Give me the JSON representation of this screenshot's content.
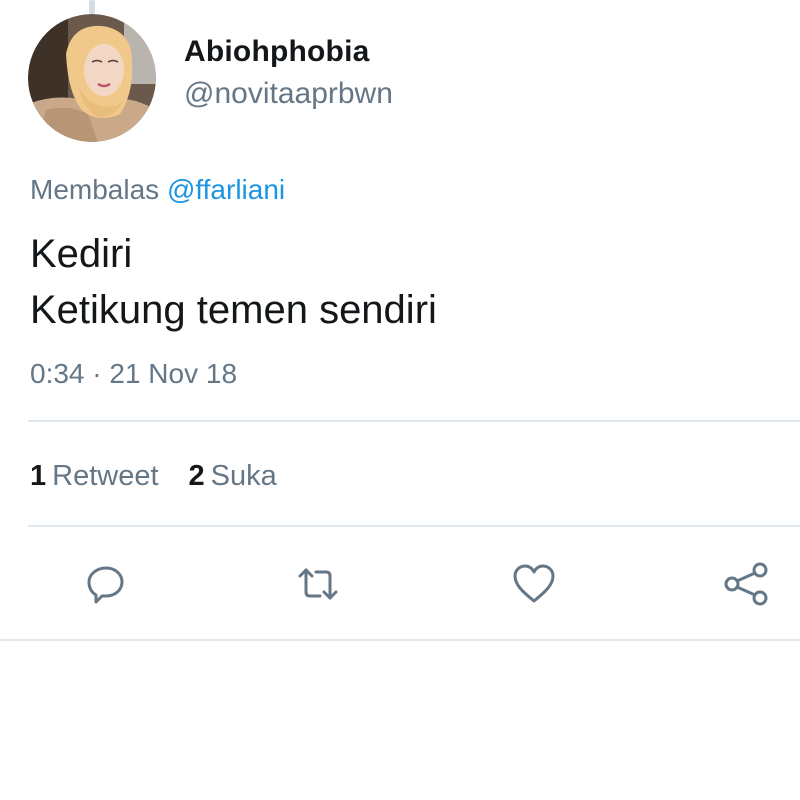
{
  "author": {
    "display_name": "Abiohphobia",
    "handle": "@novitaaprbwn"
  },
  "reply_context": {
    "prefix": "Membalas",
    "mention": "@ffarliani"
  },
  "tweet": {
    "lines": [
      "Kediri",
      "Ketikung temen sendiri"
    ],
    "timestamp": "0:34 · 21 Nov 18"
  },
  "stats": {
    "retweet_count": "1",
    "retweet_label": "Retweet",
    "like_count": "2",
    "like_label": "Suka"
  },
  "actions": [
    {
      "icon": "reply-icon"
    },
    {
      "icon": "retweet-icon"
    },
    {
      "icon": "heart-icon"
    },
    {
      "icon": "share-icon"
    }
  ],
  "colors": {
    "primary_text": "#14171a",
    "secondary_text": "#657786",
    "link": "#1b95e0",
    "divider": "#e1e8ed"
  }
}
